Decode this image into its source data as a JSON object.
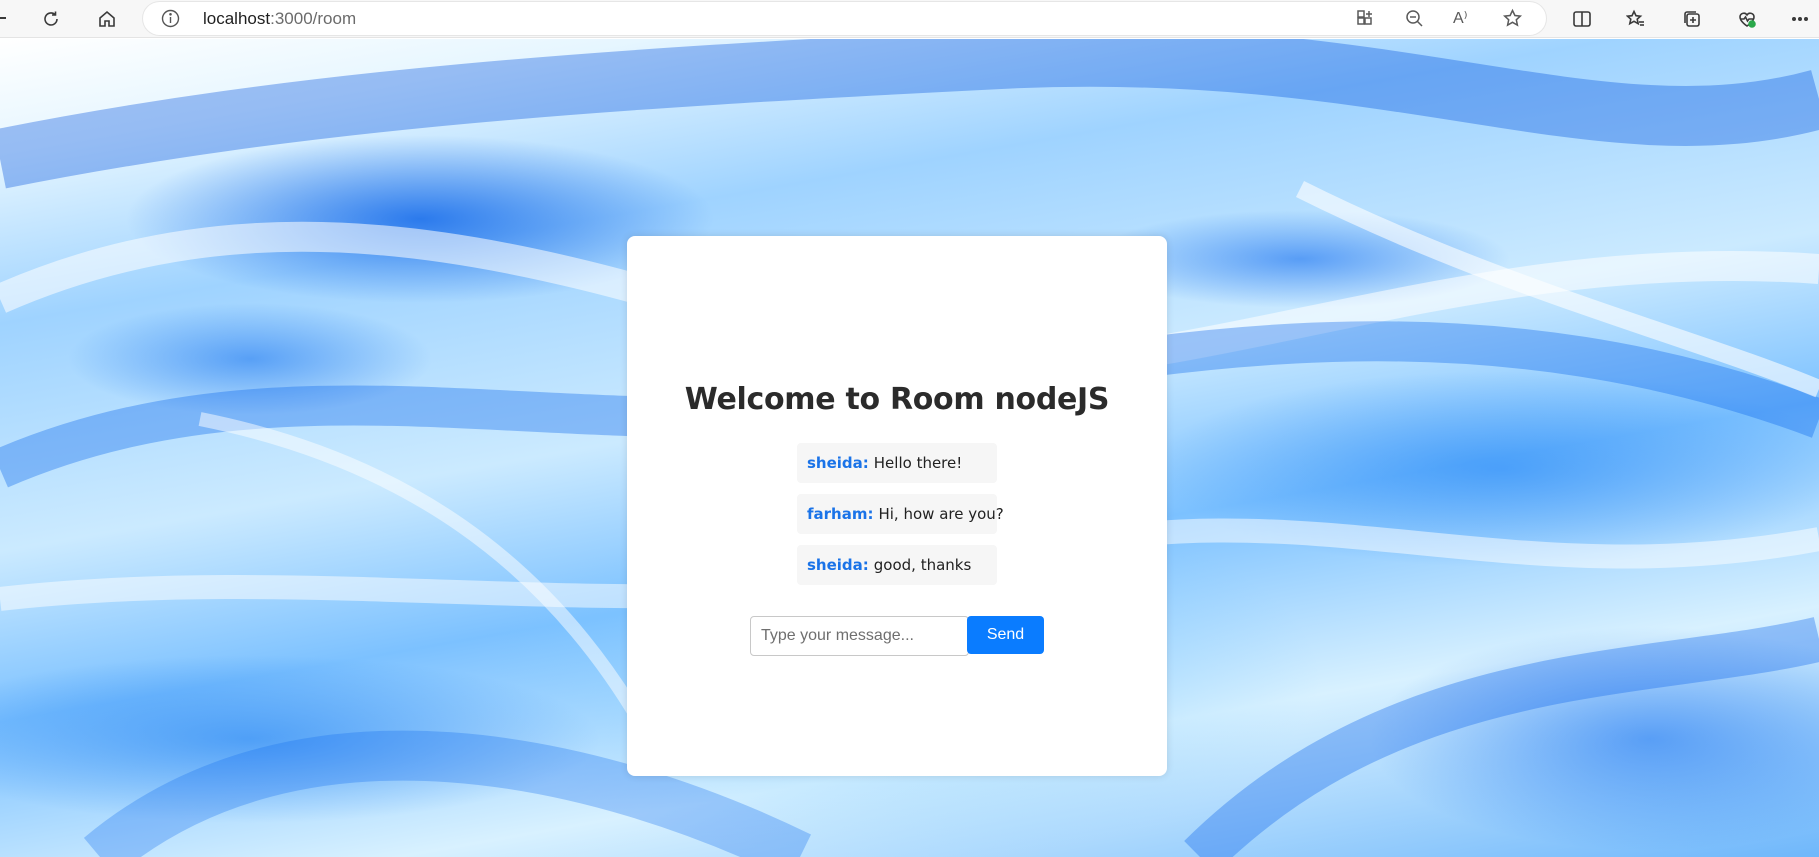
{
  "browser": {
    "url_host": "localhost",
    "url_path": ":3000/room",
    "icons": [
      "back-icon",
      "refresh-icon",
      "home-icon",
      "info-icon",
      "app-available-icon",
      "zoom-out-icon",
      "read-aloud-icon",
      "favorite-star-icon",
      "split-screen-icon",
      "favorites-icon",
      "collections-icon",
      "browser-essentials-icon",
      "more-icon"
    ],
    "read_aloud_label": "A⁾"
  },
  "page": {
    "title": "Welcome to Room nodeJS",
    "messages": [
      {
        "user": "sheida:",
        "text": "Hello there!"
      },
      {
        "user": "farham:",
        "text": "Hi, how are you?"
      },
      {
        "user": "sheida:",
        "text": "good, thanks"
      }
    ],
    "input_placeholder": "Type your message...",
    "input_value": "",
    "send_label": "Send"
  },
  "colors": {
    "accent": "#0a7cff",
    "username": "#1a73e8",
    "card": "#ffffff"
  }
}
